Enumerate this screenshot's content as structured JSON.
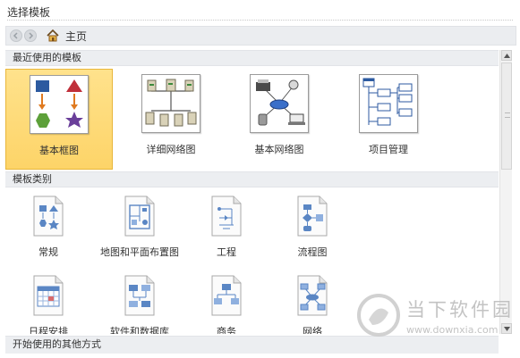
{
  "header": {
    "title": "选择模板"
  },
  "nav": {
    "home_label": "主页"
  },
  "sections": {
    "recent": "最近使用的模板",
    "categories": "模板类别",
    "other_ways": "开始使用的其他方式"
  },
  "recent_templates": [
    {
      "label": "基本框图",
      "selected": true
    },
    {
      "label": "详细网络图",
      "selected": false
    },
    {
      "label": "基本网络图",
      "selected": false
    },
    {
      "label": "项目管理",
      "selected": false
    }
  ],
  "categories": [
    {
      "label": "常规",
      "icon": "general-shapes-icon"
    },
    {
      "label": "地图和平面布置图",
      "icon": "floorplan-icon"
    },
    {
      "label": "工程",
      "icon": "engineering-icon"
    },
    {
      "label": "流程图",
      "icon": "flowchart-icon"
    },
    {
      "label": "日程安排",
      "icon": "calendar-icon"
    },
    {
      "label": "软件和数据库",
      "icon": "software-database-icon"
    },
    {
      "label": "商务",
      "icon": "business-org-icon"
    },
    {
      "label": "网络",
      "icon": "network-icon"
    }
  ],
  "watermark": {
    "title": "当下软件园",
    "url": "www.downxia.com"
  },
  "colors": {
    "selected_bg": "#fdd468",
    "section_bg": "#eceef1"
  }
}
